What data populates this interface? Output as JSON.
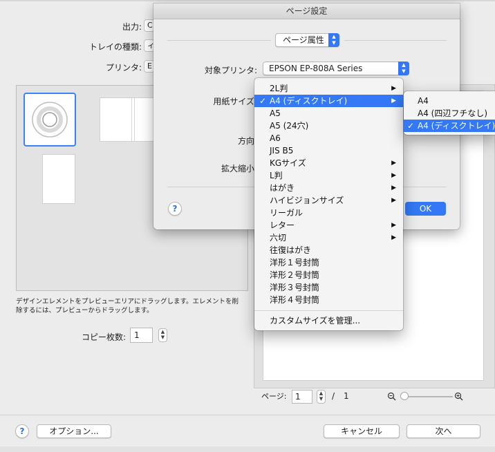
{
  "dialog": {
    "output_label": "出力:",
    "output_value": "C",
    "tray_type_label": "トレイの種類:",
    "tray_type_value": "ィ",
    "printer_label": "プリンタ:",
    "printer_value": "E",
    "instructions": "デザインエレメントをプレビューエリアにドラッグします。エレメントを削除するには、プレビューからドラッグします。",
    "copies_label": "コピー枚数:",
    "copies_value": "1",
    "page_label": "ページ:",
    "page_value": "1",
    "page_sep": "/",
    "page_total": "1",
    "options_button": "オプション...",
    "cancel_button": "キャンセル",
    "next_button": "次へ",
    "help": "?"
  },
  "sheet": {
    "title": "ページ設定",
    "section_popup": "ページ属性",
    "target_printer_label": "対象プリンタ:",
    "target_printer_value": "EPSON EP-808A Series",
    "paper_size_label": "用紙サイズ",
    "orientation_label": "方向",
    "scale_label": "拡大縮小",
    "ok_button": "OK",
    "help": "?"
  },
  "menu": {
    "items": [
      {
        "label": "2L判",
        "submenu": "▶",
        "check": ""
      },
      {
        "label": "A4 (ディスクトレイ)",
        "submenu": "▶",
        "check": "✓"
      },
      {
        "label": "A5",
        "submenu": "",
        "check": ""
      },
      {
        "label": "A5 (24穴)",
        "submenu": "",
        "check": ""
      },
      {
        "label": "A6",
        "submenu": "",
        "check": ""
      },
      {
        "label": "JIS B5",
        "submenu": "",
        "check": ""
      },
      {
        "label": "KGサイズ",
        "submenu": "▶",
        "check": ""
      },
      {
        "label": "L判",
        "submenu": "▶",
        "check": ""
      },
      {
        "label": "はがき",
        "submenu": "▶",
        "check": ""
      },
      {
        "label": "ハイビジョンサイズ",
        "submenu": "▶",
        "check": ""
      },
      {
        "label": "リーガル",
        "submenu": "",
        "check": ""
      },
      {
        "label": "レター",
        "submenu": "▶",
        "check": ""
      },
      {
        "label": "六切",
        "submenu": "▶",
        "check": ""
      },
      {
        "label": "往復はがき",
        "submenu": "",
        "check": ""
      },
      {
        "label": "洋形１号封筒",
        "submenu": "",
        "check": ""
      },
      {
        "label": "洋形２号封筒",
        "submenu": "",
        "check": ""
      },
      {
        "label": "洋形３号封筒",
        "submenu": "",
        "check": ""
      },
      {
        "label": "洋形４号封筒",
        "submenu": "",
        "check": ""
      }
    ],
    "manage": "カスタムサイズを管理..."
  },
  "submenu": {
    "items": [
      {
        "label": "A4",
        "check": ""
      },
      {
        "label": "A4 (四辺フチなし)",
        "check": ""
      },
      {
        "label": "A4 (ディスクトレイ)",
        "check": "✓"
      }
    ]
  },
  "icons": {
    "zoom_out": "🔍",
    "zoom_in": "🔍"
  },
  "colors": {
    "accent": "#3478f6"
  }
}
